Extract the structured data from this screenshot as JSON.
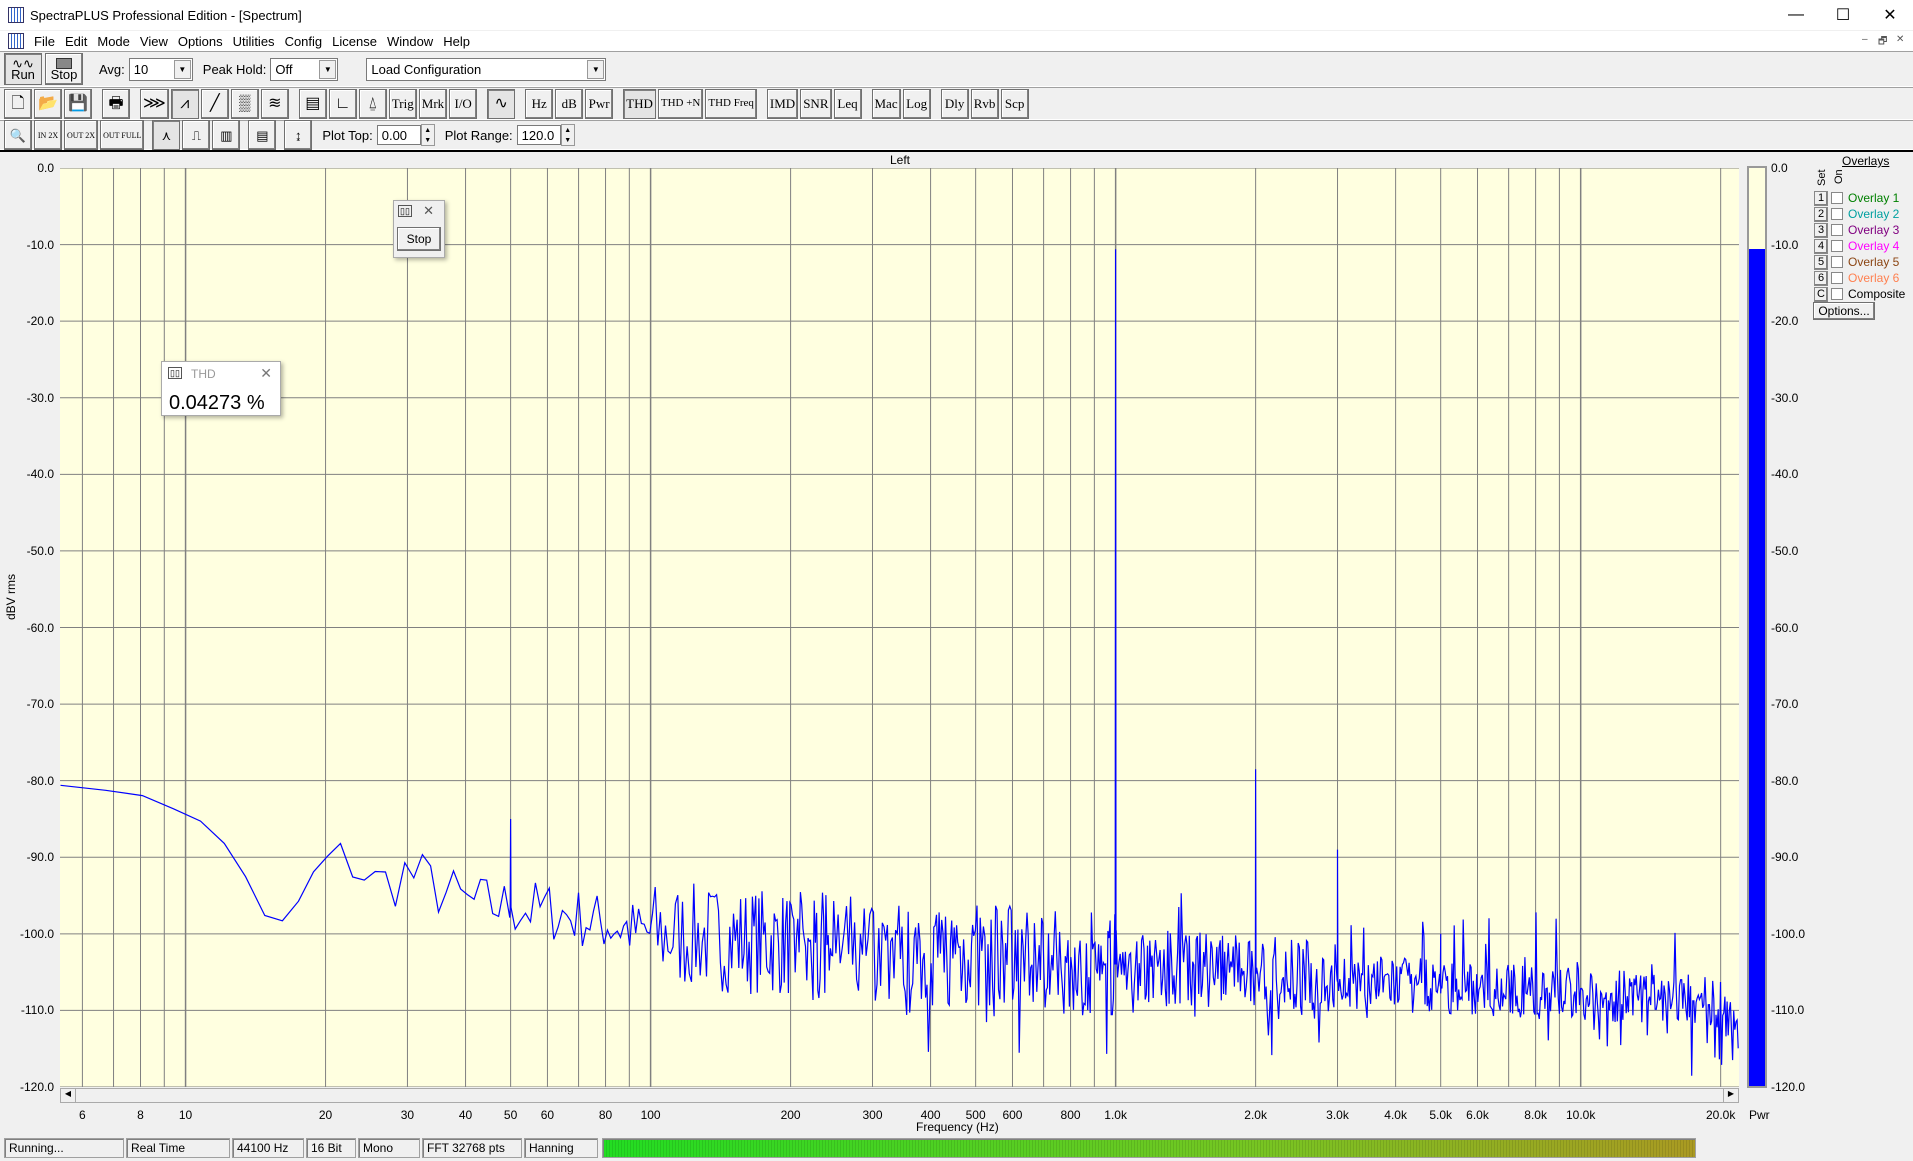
{
  "window": {
    "title": "SpectraPLUS Professional Edition - [Spectrum]",
    "minimize": "—",
    "maximize": "☐",
    "close": "✕",
    "mdi": [
      "–",
      "🗗",
      "✕"
    ]
  },
  "menu": [
    "File",
    "Edit",
    "Mode",
    "View",
    "Options",
    "Utilities",
    "Config",
    "License",
    "Window",
    "Help"
  ],
  "toolbar1": {
    "run": "Run",
    "stop": "Stop",
    "avg_label": "Avg:",
    "avg_value": "10",
    "peak_label": "Peak Hold:",
    "peak_value": "Off",
    "config_value": "Load Configuration"
  },
  "toolbar2": {
    "groups": [
      [
        {
          "n": "new-icon",
          "g": "🗋"
        },
        {
          "n": "open-icon",
          "g": "📂"
        },
        {
          "n": "save-icon",
          "g": "💾"
        }
      ],
      [
        {
          "n": "print-icon",
          "g": "🖶"
        }
      ],
      [
        {
          "n": "time-series-icon",
          "g": "⋙"
        },
        {
          "n": "spectrum-icon",
          "g": "⩘",
          "p": true
        },
        {
          "n": "phase-icon",
          "g": "╱"
        },
        {
          "n": "spectrogram-icon",
          "g": "▒"
        },
        {
          "n": "3d-surface-icon",
          "g": "≋"
        }
      ],
      [
        {
          "n": "panel-icon",
          "g": "▤"
        },
        {
          "n": "axis-icon",
          "g": "∟"
        },
        {
          "n": "probe-icon",
          "g": "⍙"
        },
        {
          "n": "trig",
          "t": "Trig"
        },
        {
          "n": "mrk",
          "t": "Mrk"
        },
        {
          "n": "io",
          "t": "I/O"
        }
      ],
      [
        {
          "n": "signal-generator-icon",
          "g": "∿",
          "p": true
        }
      ],
      [
        {
          "n": "hz",
          "t": "Hz"
        },
        {
          "n": "db",
          "t": "dB"
        },
        {
          "n": "pwr",
          "t": "Pwr"
        }
      ],
      [
        {
          "n": "thd",
          "t": "THD",
          "p": true
        },
        {
          "n": "thd-n",
          "t": "THD +N"
        },
        {
          "n": "thd-freq",
          "t": "THD Freq"
        }
      ],
      [
        {
          "n": "imd",
          "t": "IMD"
        },
        {
          "n": "snr",
          "t": "SNR"
        },
        {
          "n": "leq",
          "t": "Leq"
        }
      ],
      [
        {
          "n": "mac",
          "t": "Mac"
        },
        {
          "n": "log",
          "t": "Log"
        }
      ],
      [
        {
          "n": "dly",
          "t": "Dly"
        },
        {
          "n": "rvb",
          "t": "Rvb"
        },
        {
          "n": "scp",
          "t": "Scp"
        }
      ]
    ]
  },
  "toolbar3": {
    "zoom_in2x": "IN 2X",
    "zoom_out2x": "OUT 2X",
    "zoom_outfull": "OUT FULL",
    "plot_top_label": "Plot Top:",
    "plot_top": "0.00",
    "plot_range_label": "Plot Range:",
    "plot_range": "120.0"
  },
  "stop_window": {
    "button": "Stop"
  },
  "thd_window": {
    "title": "THD",
    "value": "0.04273 %"
  },
  "overlays": {
    "title": "Overlays",
    "set_label": "Set",
    "on_label": "On",
    "items": [
      {
        "set": "1",
        "label": "Overlay 1",
        "color": "#008000"
      },
      {
        "set": "2",
        "label": "Overlay 2",
        "color": "#00a0a0"
      },
      {
        "set": "3",
        "label": "Overlay 3",
        "color": "#800080"
      },
      {
        "set": "4",
        "label": "Overlay 4",
        "color": "#ff00ff"
      },
      {
        "set": "5",
        "label": "Overlay 5",
        "color": "#8b4513"
      },
      {
        "set": "6",
        "label": "Overlay 6",
        "color": "#ff8050"
      },
      {
        "set": "C",
        "label": "Composite",
        "color": "#000000"
      }
    ],
    "options": "Options..."
  },
  "meter": {
    "label": "Pwr",
    "level_db": -10.6,
    "color": "#0000ff"
  },
  "status": {
    "state": "Running...",
    "mode": "Real Time",
    "rate": "44100 Hz",
    "bits": "16 Bit",
    "channels": "Mono",
    "fft": "FFT 32768 pts",
    "window": "Hanning"
  },
  "chart_data": {
    "type": "line",
    "title": "Left",
    "xlabel": "Frequency (Hz)",
    "ylabel": "dBV rms",
    "xscale": "log",
    "xlim": [
      5.37,
      21900
    ],
    "ylim": [
      -120,
      0
    ],
    "yticks": [
      "0.0",
      "-10.0",
      "-20.0",
      "-30.0",
      "-40.0",
      "-50.0",
      "-60.0",
      "-70.0",
      "-80.0",
      "-90.0",
      "-100.0",
      "-110.0",
      "-120.0"
    ],
    "xticks": [
      {
        "v": 6,
        "l": "6"
      },
      {
        "v": 8,
        "l": "8"
      },
      {
        "v": 10,
        "l": "10"
      },
      {
        "v": 20,
        "l": "20"
      },
      {
        "v": 30,
        "l": "30"
      },
      {
        "v": 40,
        "l": "40"
      },
      {
        "v": 50,
        "l": "50"
      },
      {
        "v": 60,
        "l": "60"
      },
      {
        "v": 80,
        "l": "80"
      },
      {
        "v": 100,
        "l": "100"
      },
      {
        "v": 200,
        "l": "200"
      },
      {
        "v": 300,
        "l": "300"
      },
      {
        "v": 400,
        "l": "400"
      },
      {
        "v": 500,
        "l": "500"
      },
      {
        "v": 600,
        "l": "600"
      },
      {
        "v": 800,
        "l": "800"
      },
      {
        "v": 1000,
        "l": "1.0k"
      },
      {
        "v": 2000,
        "l": "2.0k"
      },
      {
        "v": 3000,
        "l": "3.0k"
      },
      {
        "v": 4000,
        "l": "4.0k"
      },
      {
        "v": 5000,
        "l": "5.0k"
      },
      {
        "v": 6000,
        "l": "6.0k"
      },
      {
        "v": 8000,
        "l": "8.0k"
      },
      {
        "v": 10000,
        "l": "10.0k"
      },
      {
        "v": 20000,
        "l": "20.0k"
      }
    ],
    "series": [
      {
        "name": "Left",
        "color": "#0000ff",
        "floor": [
          [
            5.37,
            -80
          ],
          [
            6,
            -80.5
          ],
          [
            7,
            -82.2
          ],
          [
            8,
            -81.6
          ],
          [
            9,
            -82.8
          ],
          [
            10,
            -84
          ],
          [
            11,
            -86
          ],
          [
            12,
            -88
          ],
          [
            13,
            -90
          ],
          [
            14,
            -95
          ],
          [
            15,
            -98.6
          ],
          [
            17,
            -98.6
          ],
          [
            18,
            -93
          ],
          [
            20,
            -91
          ],
          [
            23,
            -90.5
          ],
          [
            26,
            -94
          ],
          [
            30,
            -92
          ],
          [
            40,
            -96
          ],
          [
            60,
            -97
          ],
          [
            100,
            -100
          ],
          [
            300,
            -102
          ],
          [
            1000,
            -104
          ],
          [
            3000,
            -106
          ],
          [
            10000,
            -108
          ],
          [
            20000,
            -109
          ],
          [
            21900,
            -113
          ]
        ],
        "peaks": [
          [
            50,
            -85
          ],
          [
            1000,
            -10.6
          ],
          [
            2000,
            -78.5
          ],
          [
            3000,
            -89
          ],
          [
            5000,
            -100
          ]
        ]
      }
    ]
  }
}
